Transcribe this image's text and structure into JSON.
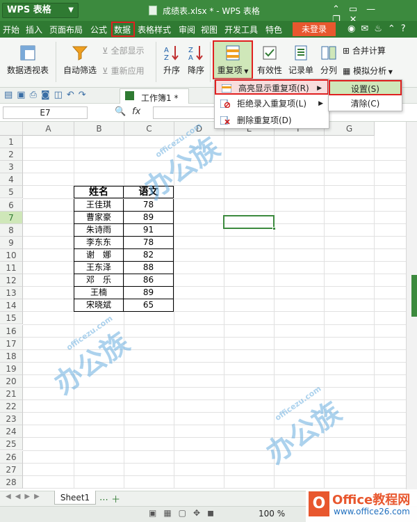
{
  "app": {
    "name": "WPS 表格",
    "doc_title": "成绩表.xlsx * - WPS 表格"
  },
  "menu": {
    "items": [
      "开始",
      "插入",
      "页面布局",
      "公式",
      "数据",
      "表格样式",
      "审阅",
      "视图",
      "开发工具",
      "特色"
    ],
    "login": "未登录",
    "help": "?"
  },
  "ribbon": {
    "pivot": "数据透视表",
    "autofilter": "自动筛选",
    "show_all": "全部显示",
    "reapply": "重新应用",
    "sort_asc": "升序",
    "sort_desc": "降序",
    "duplicates": "重复项",
    "validity": "有效性",
    "record": "记录单",
    "split": "分列",
    "merge_calc": "合并计算",
    "simulate": "模拟分析"
  },
  "qat": {
    "workbook_tab": "工作簿1 *"
  },
  "formula": {
    "name_box": "E7",
    "fx": "fx"
  },
  "grid": {
    "columns": [
      "A",
      "B",
      "C",
      "D",
      "E",
      "F",
      "G"
    ],
    "rows": [
      "1",
      "2",
      "3",
      "4",
      "5",
      "6",
      "7",
      "8",
      "9",
      "10",
      "11",
      "12",
      "13",
      "14",
      "15",
      "16",
      "17",
      "18",
      "19",
      "20",
      "21",
      "22",
      "23",
      "24",
      "25",
      "26",
      "27",
      "28"
    ],
    "table": {
      "headers": [
        "姓名",
        "语文"
      ],
      "rows": [
        [
          "王佳琪",
          "78"
        ],
        [
          "曹家豪",
          "89"
        ],
        [
          "朱诗雨",
          "91"
        ],
        [
          "李东东",
          "78"
        ],
        [
          "谢　娜",
          "82"
        ],
        [
          "王东泽",
          "88"
        ],
        [
          "邓　乐",
          "86"
        ],
        [
          "王楠",
          "89"
        ],
        [
          "宋晓斌",
          "65"
        ]
      ]
    }
  },
  "dropdown": {
    "items": [
      "高亮显示重复项(R)",
      "拒绝录入重复项(L)",
      "删除重复项(D)"
    ]
  },
  "submenu": {
    "items": [
      "设置(S)",
      "清除(C)"
    ]
  },
  "sheets": {
    "active": "Sheet1"
  },
  "status": {
    "zoom": "100 %"
  },
  "brand": {
    "name": "Office教程网",
    "url": "www.office26.com"
  },
  "watermark": {
    "text": "办公族",
    "url": "officezu.com"
  }
}
